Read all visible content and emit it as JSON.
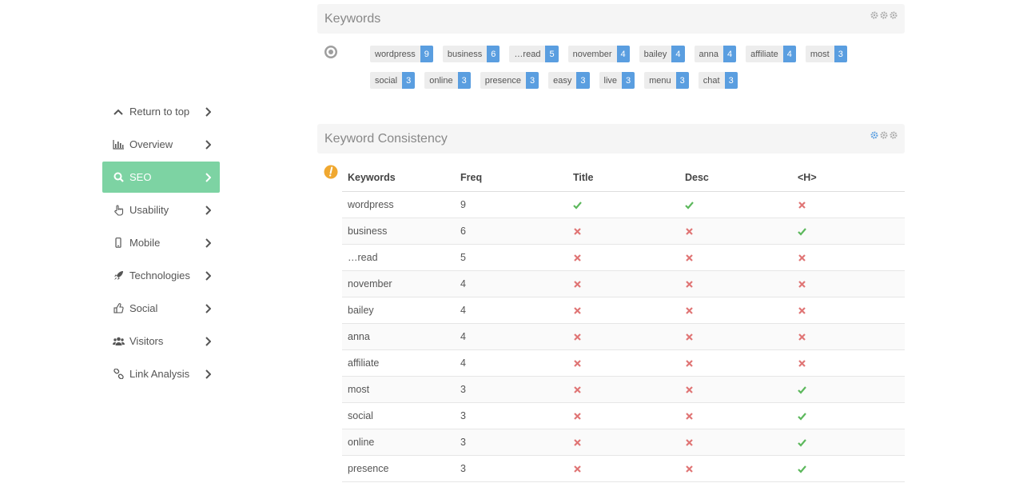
{
  "sidebar": {
    "items": [
      {
        "label": "Return to top",
        "icon": "chevron-up-icon",
        "active": false
      },
      {
        "label": "Overview",
        "icon": "bar-chart-icon",
        "active": false
      },
      {
        "label": "SEO",
        "icon": "search-icon",
        "active": true
      },
      {
        "label": "Usability",
        "icon": "pointer-hand-icon",
        "active": false
      },
      {
        "label": "Mobile",
        "icon": "mobile-phone-icon",
        "active": false
      },
      {
        "label": "Technologies",
        "icon": "rocket-icon",
        "active": false
      },
      {
        "label": "Social",
        "icon": "thumbs-up-icon",
        "active": false
      },
      {
        "label": "Visitors",
        "icon": "users-icon",
        "active": false
      },
      {
        "label": "Link Analysis",
        "icon": "link-icon",
        "active": false
      }
    ],
    "active_color": "#7dd3a3"
  },
  "keywords_panel": {
    "title": "Keywords",
    "status_icon": "neutral-circle-icon",
    "tags": [
      {
        "word": "wordpress",
        "count": "9"
      },
      {
        "word": "business",
        "count": "6"
      },
      {
        "word": "…read",
        "count": "5"
      },
      {
        "word": "november",
        "count": "4"
      },
      {
        "word": "bailey",
        "count": "4"
      },
      {
        "word": "anna",
        "count": "4"
      },
      {
        "word": "affiliate",
        "count": "4"
      },
      {
        "word": "most",
        "count": "3"
      },
      {
        "word": "social",
        "count": "3"
      },
      {
        "word": "online",
        "count": "3"
      },
      {
        "word": "presence",
        "count": "3"
      },
      {
        "word": "easy",
        "count": "3"
      },
      {
        "word": "live",
        "count": "3"
      },
      {
        "word": "menu",
        "count": "3"
      },
      {
        "word": "chat",
        "count": "3"
      }
    ],
    "count_color": "#5a9ee0"
  },
  "consistency_panel": {
    "title": "Keyword Consistency",
    "status_icon": "warning-icon",
    "columns": [
      "Keywords",
      "Freq",
      "Title",
      "Desc",
      "<H>"
    ],
    "rows": [
      {
        "keyword": "wordpress",
        "freq": "9",
        "title": true,
        "desc": true,
        "h": false
      },
      {
        "keyword": "business",
        "freq": "6",
        "title": false,
        "desc": false,
        "h": true
      },
      {
        "keyword": "…read",
        "freq": "5",
        "title": false,
        "desc": false,
        "h": false
      },
      {
        "keyword": "november",
        "freq": "4",
        "title": false,
        "desc": false,
        "h": false
      },
      {
        "keyword": "bailey",
        "freq": "4",
        "title": false,
        "desc": false,
        "h": false
      },
      {
        "keyword": "anna",
        "freq": "4",
        "title": false,
        "desc": false,
        "h": false
      },
      {
        "keyword": "affiliate",
        "freq": "4",
        "title": false,
        "desc": false,
        "h": false
      },
      {
        "keyword": "most",
        "freq": "3",
        "title": false,
        "desc": false,
        "h": true
      },
      {
        "keyword": "social",
        "freq": "3",
        "title": false,
        "desc": false,
        "h": true
      },
      {
        "keyword": "online",
        "freq": "3",
        "title": false,
        "desc": false,
        "h": true
      },
      {
        "keyword": "presence",
        "freq": "3",
        "title": false,
        "desc": false,
        "h": true
      }
    ],
    "check_color": "#5cb85c",
    "cross_color": "#e07575"
  }
}
